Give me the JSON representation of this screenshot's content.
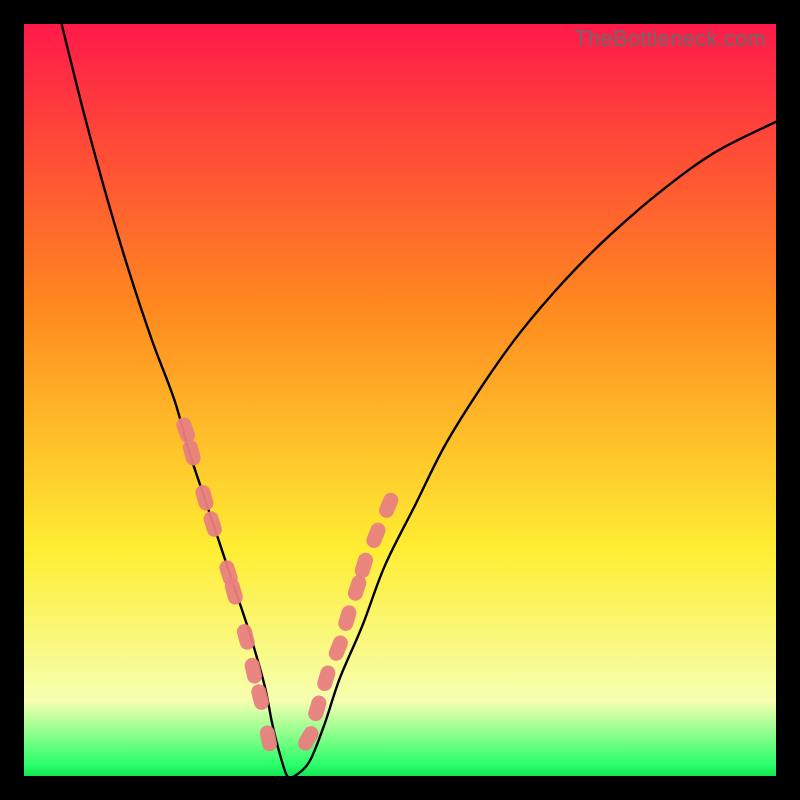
{
  "watermark": "TheBottleneck.com",
  "colors": {
    "frame": "#000000",
    "curve": "#000000",
    "bead": "#e98080",
    "grad_top": "#ff1a4a",
    "grad_orange": "#ff8a1f",
    "grad_yellow": "#ffee33",
    "grad_lemon": "#f6ffb0",
    "grad_green": "#2aff6a"
  },
  "chart_data": {
    "type": "line",
    "title": "",
    "xlabel": "",
    "ylabel": "",
    "xlim": [
      0,
      100
    ],
    "ylim": [
      0,
      100
    ],
    "grid": false,
    "legend": false,
    "series": [
      {
        "name": "curve",
        "x": [
          5,
          8,
          11,
          14,
          17,
          20,
          22,
          24,
          26,
          28,
          30,
          32,
          33,
          34,
          35,
          36,
          38,
          40,
          42,
          45,
          48,
          52,
          56,
          61,
          66,
          72,
          78,
          85,
          92,
          100
        ],
        "y": [
          100,
          88,
          77,
          67,
          58,
          50,
          43,
          37,
          31,
          25,
          19,
          12,
          7,
          3,
          0,
          0,
          2,
          7,
          13,
          20,
          28,
          36,
          44,
          52,
          59,
          66,
          72,
          78,
          83,
          87
        ]
      }
    ],
    "beads_left": {
      "x": [
        21.5,
        22.3,
        24.0,
        25.1,
        27.2,
        27.9,
        29.5,
        30.5,
        31.4,
        32.5
      ],
      "y": [
        46,
        43,
        37,
        33.5,
        27,
        24.5,
        18.5,
        14,
        10.5,
        5
      ]
    },
    "beads_right": {
      "x": [
        37.8,
        39.0,
        40.2,
        41.8,
        43.0,
        44.3,
        45.2,
        46.8,
        48.5
      ],
      "y": [
        5,
        9,
        13,
        17,
        21,
        25,
        28,
        32,
        36
      ]
    },
    "background_gradient_stops": [
      {
        "pos": 0.0,
        "color": "#ff1a4a"
      },
      {
        "pos": 0.38,
        "color": "#ff8a1f"
      },
      {
        "pos": 0.7,
        "color": "#ffee33"
      },
      {
        "pos": 0.9,
        "color": "#f6ffb0"
      },
      {
        "pos": 0.985,
        "color": "#2aff6a"
      },
      {
        "pos": 1.0,
        "color": "#16e552"
      }
    ]
  }
}
